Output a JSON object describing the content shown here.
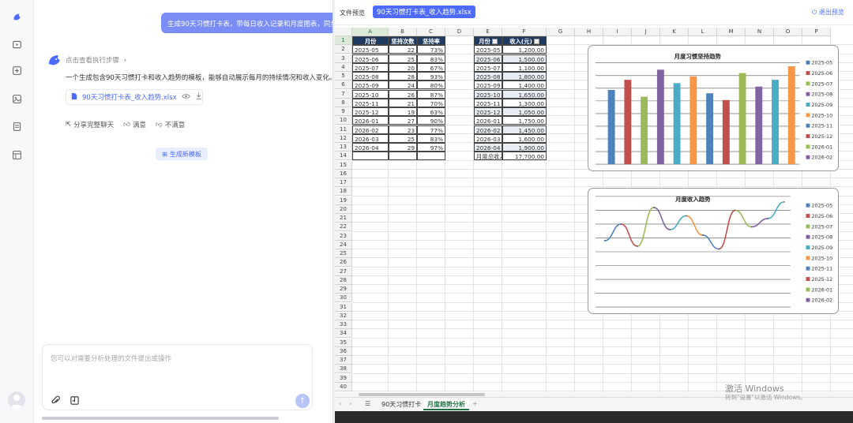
{
  "chat": {
    "user_message": "生成90天习惯打卡表，带每日收入记录和月度图表，同步显",
    "steps_label": "点击查看执行步骤",
    "bot_reply": "一个生成包含90天习惯打卡和收入趋势的模板，能够自动展示每月的持续情况和收入变化。",
    "file_name": "90天习惯打卡表_收入趋势.xlsx",
    "actions": [
      "分享完整聊天",
      "满意",
      "不满意"
    ],
    "generate_button": "生成新模板",
    "input_placeholder": "您可以对需要分析处理的文件提出或操作"
  },
  "preview": {
    "label": "文件预览",
    "tab_name": "90天习惯打卡表_收入趋势.xlsx",
    "exit_label": "退出预览"
  },
  "sheet": {
    "columns": [
      "A",
      "B",
      "C",
      "D",
      "E",
      "F",
      "G",
      "H",
      "I",
      "J",
      "K",
      "L",
      "M",
      "N",
      "O",
      "P"
    ],
    "rows": [
      "1",
      "2",
      "3",
      "4",
      "5",
      "6",
      "7",
      "8",
      "9",
      "10",
      "11",
      "12",
      "13",
      "14",
      "15",
      "16",
      "17",
      "18",
      "19",
      "20",
      "21",
      "22",
      "23",
      "24",
      "25",
      "26",
      "27",
      "28",
      "29",
      "30",
      "31",
      "32",
      "33",
      "34",
      "35",
      "36",
      "37",
      "38",
      "39",
      "40"
    ],
    "table1": {
      "headers": [
        "月份",
        "坚持次数",
        "坚持率"
      ],
      "rows": [
        [
          "2025-05",
          "22",
          "73%"
        ],
        [
          "2025-06",
          "25",
          "83%"
        ],
        [
          "2025-07",
          "20",
          "67%"
        ],
        [
          "2025-08",
          "28",
          "93%"
        ],
        [
          "2025-09",
          "24",
          "80%"
        ],
        [
          "2025-10",
          "26",
          "87%"
        ],
        [
          "2025-11",
          "21",
          "70%"
        ],
        [
          "2025-12",
          "19",
          "63%"
        ],
        [
          "2026-01",
          "27",
          "90%"
        ],
        [
          "2026-02",
          "23",
          "77%"
        ],
        [
          "2026-03",
          "25",
          "83%"
        ],
        [
          "2026-04",
          "29",
          "97%"
        ]
      ]
    },
    "table2": {
      "headers": [
        "月份",
        "收入(元)"
      ],
      "rows": [
        [
          "2025-05",
          "1,200.00"
        ],
        [
          "2025-06",
          "1,500.00"
        ],
        [
          "2025-07",
          "1,100.00"
        ],
        [
          "2025-08",
          "1,800.00"
        ],
        [
          "2025-09",
          "1,400.00"
        ],
        [
          "2025-10",
          "1,650.00"
        ],
        [
          "2025-11",
          "1,300.00"
        ],
        [
          "2025-12",
          "1,050.00"
        ],
        [
          "2026-01",
          "1,750.00"
        ],
        [
          "2026-02",
          "1,450.00"
        ],
        [
          "2026-03",
          "1,600.00"
        ],
        [
          "2026-04",
          "1,900.00"
        ]
      ],
      "total_label": "月度总收入",
      "total_value": "17,700.00"
    },
    "tabs": [
      "90天习惯打卡",
      "月度趋势分析"
    ],
    "active_tab": 1
  },
  "watermark": {
    "line1": "激活 Windows",
    "line2": "转到\"设置\"以激活 Windows。"
  },
  "colors": {
    "accent": "#4d6bfe",
    "header_fill": "#1f3a5f",
    "series": [
      "#4f81bd",
      "#c0504d",
      "#9bbb59",
      "#8064a2",
      "#4bacc6",
      "#f79646",
      "#4f81bd",
      "#c0504d",
      "#9bbb59",
      "#8064a2",
      "#4bacc6",
      "#f79646"
    ]
  },
  "chart_data": [
    {
      "type": "bar",
      "title": "月度习惯坚持趋势",
      "categories": [
        "2025-05",
        "2025-06",
        "2025-07",
        "2025-08",
        "2025-09",
        "2025-10",
        "2025-11",
        "2025-12",
        "2026-01",
        "2026-02",
        "2026-03",
        "2026-04"
      ],
      "values": [
        22,
        25,
        20,
        28,
        24,
        26,
        21,
        19,
        27,
        23,
        25,
        29
      ],
      "legend": [
        "2025-05",
        "2025-06",
        "2025-07",
        "2025-08",
        "2025-09",
        "2025-10",
        "2025-11",
        "2025-12",
        "2026-01",
        "2026-02"
      ],
      "legend_position": "right",
      "grid": true
    },
    {
      "type": "line",
      "title": "月度收入趋势",
      "categories": [
        "2025-05",
        "2025-06",
        "2025-07",
        "2025-08",
        "2025-09",
        "2025-10",
        "2025-11",
        "2025-12",
        "2026-01",
        "2026-02",
        "2026-03",
        "2026-04"
      ],
      "values": [
        1200,
        1500,
        1100,
        1800,
        1400,
        1650,
        1300,
        1050,
        1750,
        1450,
        1600,
        1900
      ],
      "legend": [
        "2025-05",
        "2025-06",
        "2025-07",
        "2025-08",
        "2025-09",
        "2025-10",
        "2025-11",
        "2025-12",
        "2026-01",
        "2026-02"
      ],
      "legend_position": "right",
      "grid": true
    }
  ]
}
